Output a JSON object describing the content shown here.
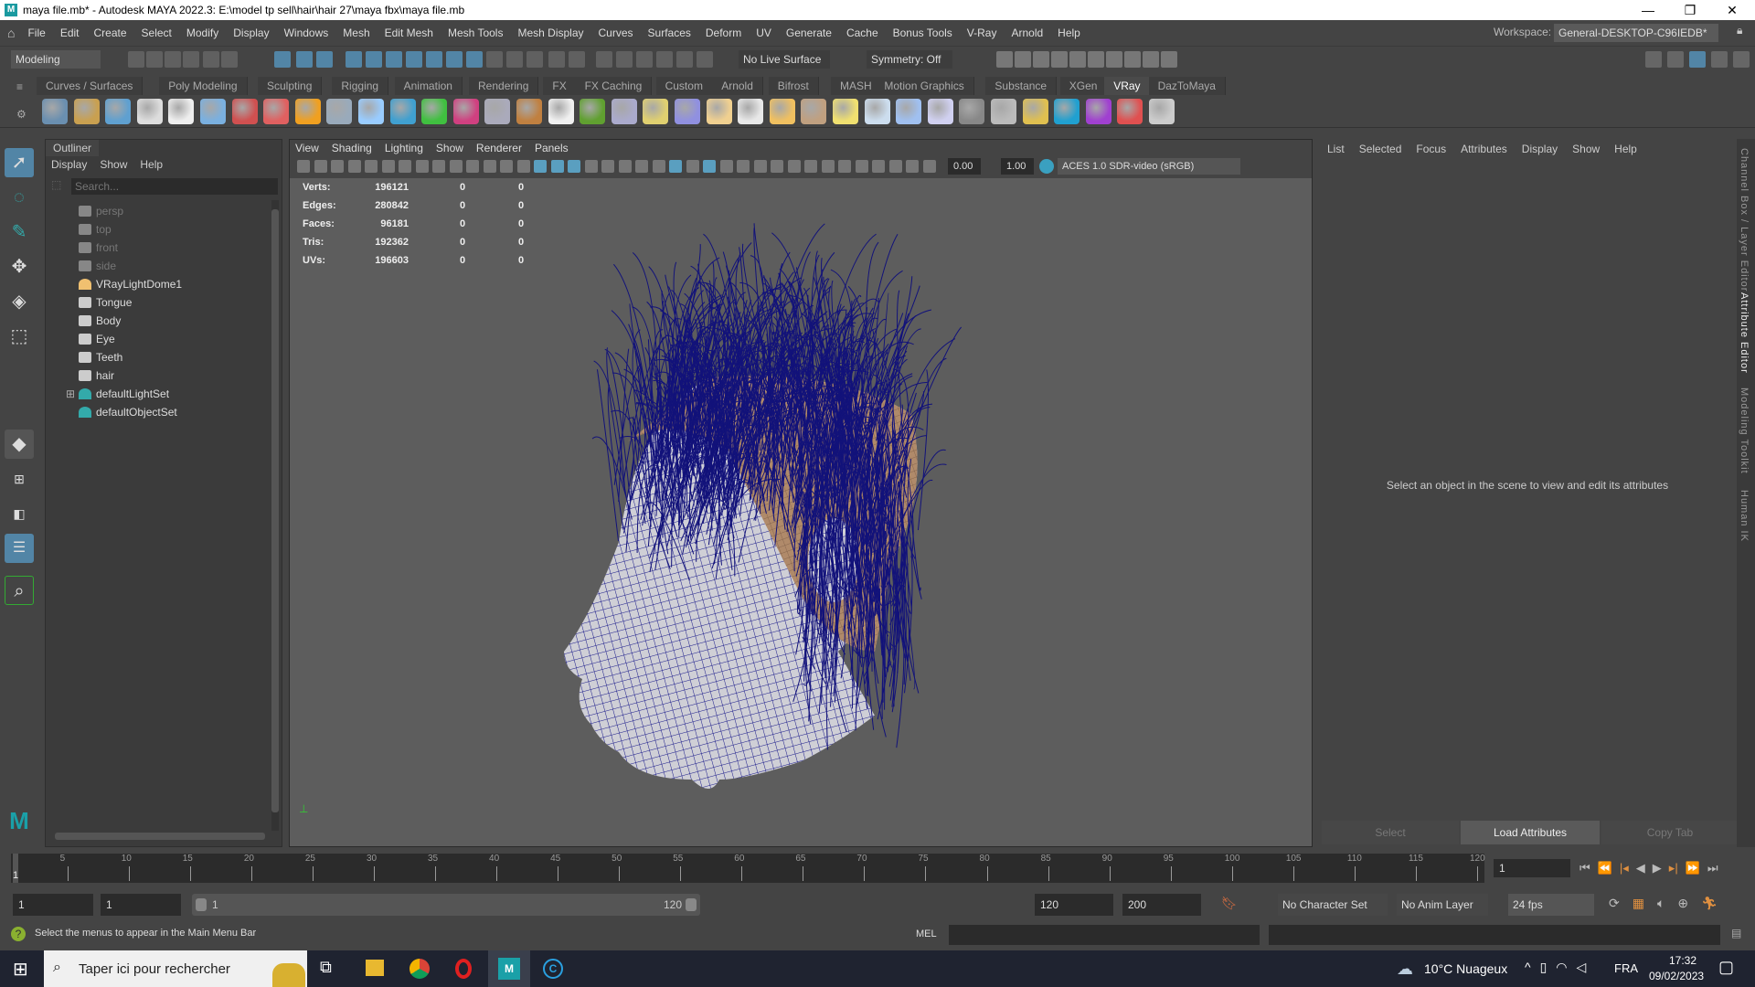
{
  "title": "maya file.mb* - Autodesk MAYA 2022.3: E:\\model tp sell\\hair\\hair 27\\maya fbx\\maya file.mb",
  "window_buttons": [
    "—",
    "❐",
    "✕"
  ],
  "menus": [
    "File",
    "Edit",
    "Create",
    "Select",
    "Modify",
    "Display",
    "Windows",
    "Mesh",
    "Edit Mesh",
    "Mesh Tools",
    "Mesh Display",
    "Curves",
    "Surfaces",
    "Deform",
    "UV",
    "Generate",
    "Cache",
    "Bonus Tools",
    "V-Ray",
    "Arnold",
    "Help"
  ],
  "workspace": {
    "label": "Workspace:",
    "value": "General-DESKTOP-C96IEDB*"
  },
  "statusline": {
    "mode": "Modeling",
    "live_surface": "No Live Surface",
    "symmetry": "Symmetry: Off"
  },
  "shelf_tabs": [
    "Curves / Surfaces",
    "Poly Modeling",
    "Sculpting",
    "Rigging",
    "Animation",
    "Rendering",
    "FX",
    "FX Caching",
    "Custom",
    "Arnold",
    "Bifrost",
    "MASH",
    "Motion Graphics",
    "Substance",
    "XGen",
    "VRay",
    "DazToMaya"
  ],
  "shelf_active": "VRay",
  "shelf_icons": [
    "#6a8fb0",
    "#c9a050",
    "#5fa0d0",
    "#ddd",
    "#eee",
    "#7ab0e0",
    "#d05050",
    "#e06060",
    "#f0a020",
    "#9ab",
    "#9cf",
    "#40a0d0",
    "#40c040",
    "#d04080",
    "#aab",
    "#c08040",
    "#f0f0f0",
    "#60a030",
    "#aac",
    "#e0d070",
    "#9090e0",
    "#f0d090",
    "#e8e8e8",
    "#f0c060",
    "#c0a080",
    "#f0e070",
    "#cde",
    "#a0c0f0",
    "#d0d0f0",
    "#888",
    "#bbb",
    "#e0c050",
    "#20a0d0",
    "#a040d0",
    "#e05050",
    "#ccc"
  ],
  "outliner": {
    "tab": "Outliner",
    "menus": [
      "Display",
      "Show",
      "Help"
    ],
    "search_placeholder": "Search...",
    "items": [
      {
        "label": "persp",
        "type": "camera",
        "dim": true
      },
      {
        "label": "top",
        "type": "camera",
        "dim": true
      },
      {
        "label": "front",
        "type": "camera",
        "dim": true
      },
      {
        "label": "side",
        "type": "camera",
        "dim": true
      },
      {
        "label": "VRayLightDome1",
        "type": "light"
      },
      {
        "label": "Tongue",
        "type": "mesh"
      },
      {
        "label": "Body",
        "type": "mesh"
      },
      {
        "label": "Eye",
        "type": "mesh"
      },
      {
        "label": "Teeth",
        "type": "mesh"
      },
      {
        "label": "hair",
        "type": "mesh"
      },
      {
        "label": "defaultLightSet",
        "type": "set",
        "expandable": true
      },
      {
        "label": "defaultObjectSet",
        "type": "set"
      }
    ]
  },
  "viewport": {
    "menus": [
      "View",
      "Shading",
      "Lighting",
      "Show",
      "Renderer",
      "Panels"
    ],
    "exposure": "0.00",
    "gamma": "1.00",
    "color_space": "ACES 1.0 SDR-video (sRGB)",
    "hud": [
      {
        "label": "Verts:",
        "v": "196121",
        "a": "0",
        "b": "0"
      },
      {
        "label": "Edges:",
        "v": "280842",
        "a": "0",
        "b": "0"
      },
      {
        "label": "Faces:",
        "v": "96181",
        "a": "0",
        "b": "0"
      },
      {
        "label": "Tris:",
        "v": "192362",
        "a": "0",
        "b": "0"
      },
      {
        "label": "UVs:",
        "v": "196603",
        "a": "0",
        "b": "0"
      }
    ]
  },
  "attribute_editor": {
    "menus": [
      "List",
      "Selected",
      "Focus",
      "Attributes",
      "Display",
      "Show",
      "Help"
    ],
    "message": "Select an object in the scene to view and edit its attributes",
    "buttons": [
      "Select",
      "Load Attributes",
      "Copy Tab"
    ]
  },
  "side_tabs": [
    "Channel Box / Layer Editor",
    "Attribute Editor",
    "Modeling Toolkit",
    "Human IK"
  ],
  "timeline": {
    "ticks": [
      "5",
      "10",
      "15",
      "20",
      "25",
      "30",
      "35",
      "40",
      "45",
      "50",
      "55",
      "60",
      "65",
      "70",
      "75",
      "80",
      "85",
      "90",
      "95",
      "100",
      "105",
      "110",
      "115",
      "120"
    ],
    "current_marker": "1",
    "current_frame": "1"
  },
  "range": {
    "start": "1",
    "playback_start": "1",
    "slider_start": "1",
    "slider_end": "120",
    "playback_end": "120",
    "end": "200",
    "character_set": "No Character Set",
    "anim_layer": "No Anim Layer",
    "fps": "24 fps"
  },
  "command": {
    "help": "Select the menus to appear in the Main Menu Bar",
    "lang": "MEL"
  },
  "taskbar": {
    "search": "Taper ici pour rechercher",
    "weather": "10°C  Nuageux",
    "lang": "FRA",
    "time": "17:32",
    "date": "09/02/2023"
  }
}
